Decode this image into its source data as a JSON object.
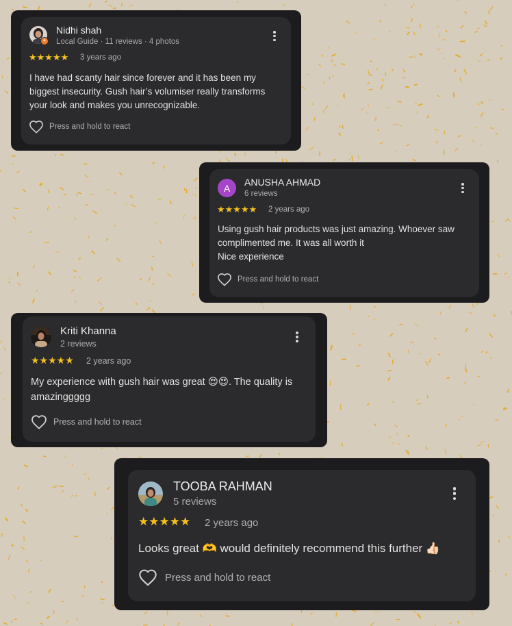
{
  "colors": {
    "background": "#d6cdbd",
    "speckle": "#e9a71b",
    "frame": "#1c1c1e",
    "card": "#2b2b2d",
    "star": "#f4c01e",
    "letter_avatar": "#a545c7"
  },
  "reviews": [
    {
      "name": "Nidhi shah",
      "meta": "Local Guide · 11 reviews · 4 photos",
      "rating": 5,
      "stars": "★★★★★",
      "time": "3 years ago",
      "text_lines": [
        "I have had scanty hair since forever and it has been my biggest insecurity. Gush hair’s volumiser really transforms your look and makes you unrecognizable."
      ],
      "react_label": "Press and hold to react",
      "avatar_icon": "profile-photo",
      "badge_icon": "local-guide-badge"
    },
    {
      "name": "ANUSHA AHMAD",
      "meta": "6 reviews",
      "avatar_letter": "A",
      "rating": 5,
      "stars": "★★★★★",
      "time": "2 years ago",
      "text_lines": [
        "Using gush hair products was just amazing. Whoever saw complimented me. It was all worth it",
        "Nice experience"
      ],
      "react_label": "Press and hold to react"
    },
    {
      "name": "Kriti Khanna",
      "meta": "2 reviews",
      "rating": 5,
      "stars": "★★★★★",
      "time": "2 years ago",
      "text_lines": [
        "My experience with gush hair was great 😍😍. The quality is amazinggggg"
      ],
      "react_label": "Press and hold to react",
      "avatar_icon": "profile-photo"
    },
    {
      "name": "TOOBA RAHMAN",
      "meta": "5 reviews",
      "rating": 5,
      "stars": "★★★★★",
      "time": "2 years ago",
      "text_lines": [
        "Looks great 🫶 would definitely recommend this further 👍🏻"
      ],
      "react_label": "Press and hold to react",
      "avatar_icon": "profile-photo"
    }
  ]
}
